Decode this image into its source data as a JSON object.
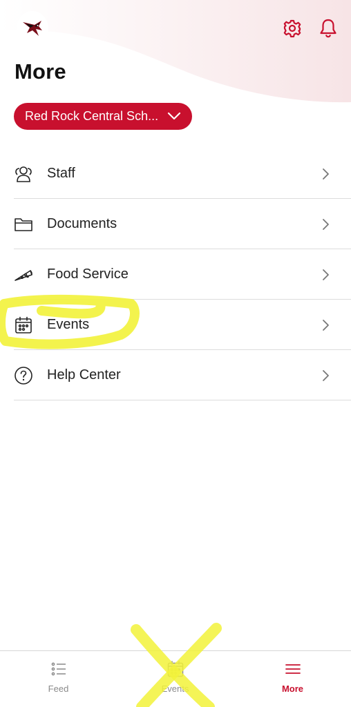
{
  "header": {
    "logo": "red-rock-hawk-logo",
    "settings_icon": "gear-icon",
    "notifications_icon": "bell-icon",
    "accent_color": "#c8102e"
  },
  "page": {
    "title": "More"
  },
  "school_selector": {
    "label": "Red Rock Central Sch..."
  },
  "menu": {
    "items": [
      {
        "label": "Staff",
        "icon": "staff-icon"
      },
      {
        "label": "Documents",
        "icon": "folder-icon"
      },
      {
        "label": "Food Service",
        "icon": "pizza-icon"
      },
      {
        "label": "Events",
        "icon": "calendar-icon"
      },
      {
        "label": "Help Center",
        "icon": "help-icon"
      }
    ]
  },
  "tabbar": {
    "tabs": [
      {
        "label": "Feed",
        "icon": "feed-icon",
        "active": false
      },
      {
        "label": "Events",
        "icon": "calendar-icon",
        "active": false
      },
      {
        "label": "More",
        "icon": "menu-icon",
        "active": true
      }
    ]
  },
  "annotations": {
    "highlight_color": "#f2f23a"
  }
}
